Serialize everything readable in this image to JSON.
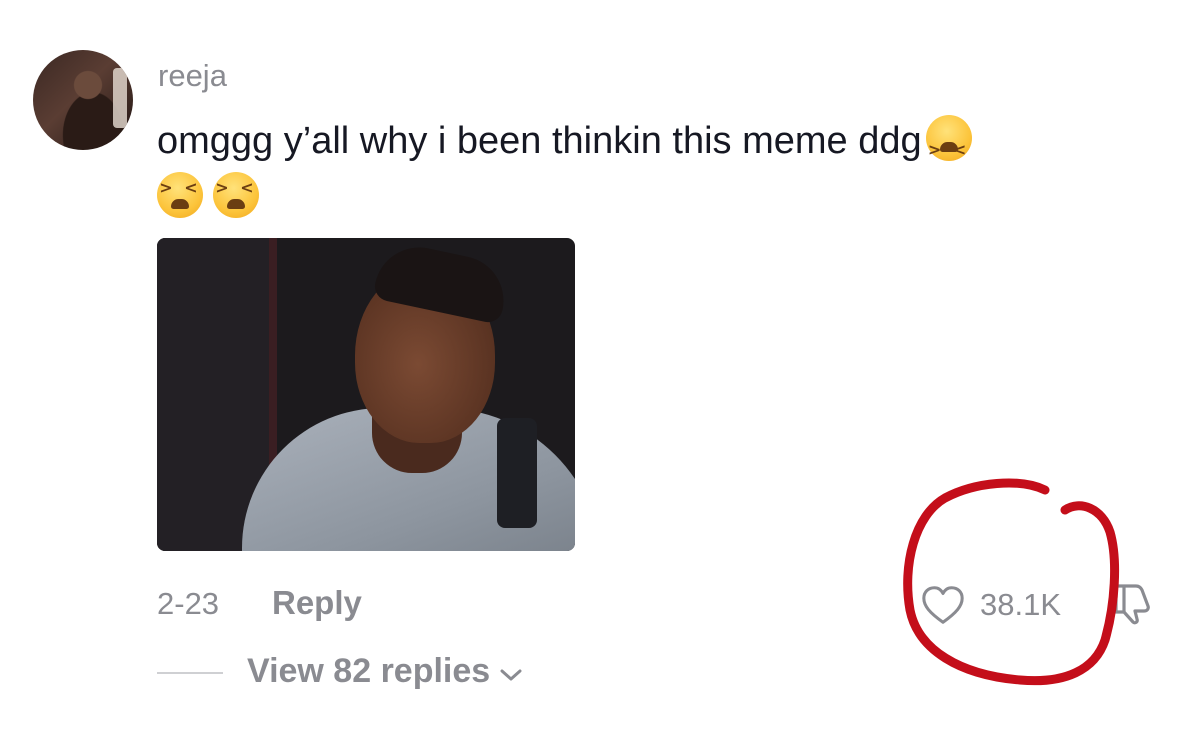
{
  "comment": {
    "username": "reeja",
    "text": "omggg y’all why i been thinkin this meme ddg",
    "emoji_name": "tired-face-emoji",
    "date": "2-23",
    "reply_label": "Reply",
    "like_count": "38.1K",
    "view_replies_label": "View 82 replies"
  },
  "annotation": {
    "color": "#c40e1a"
  },
  "colors": {
    "text": "#161823",
    "muted": "#8a8b91"
  },
  "icons": [
    "heart-icon",
    "dislike-icon",
    "chevron-down-icon",
    "tired-face-emoji"
  ]
}
